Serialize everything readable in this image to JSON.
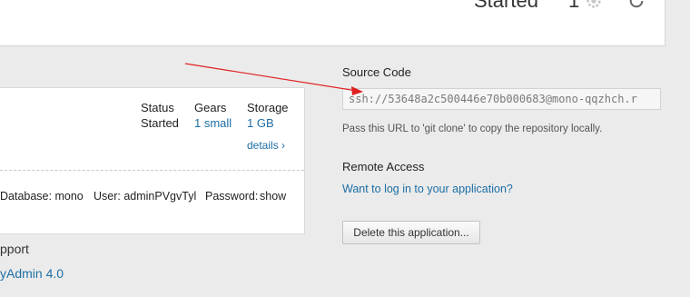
{
  "header": {
    "state": "Started",
    "gear_count": "1"
  },
  "app": {
    "status_label": "Status",
    "status_value": "Started",
    "gears_label": "Gears",
    "gears_value": "1 small",
    "storage_label": "Storage",
    "storage_value": "1 GB",
    "details_link": "details ›",
    "database_text": "Database: mono",
    "user_text": "User: adminPVgvTyl",
    "password_label": "Password:",
    "password_link": "show"
  },
  "support": {
    "label": "pport",
    "link": "yAdmin 4.0"
  },
  "source_code": {
    "title": "Source Code",
    "url": "ssh://53648a2c500446e70b000683@mono-qqzhch.r",
    "help": "Pass this URL to 'git clone' to copy the repository locally."
  },
  "remote_access": {
    "title": "Remote Access",
    "link": "Want to log in to your application?"
  },
  "actions": {
    "delete_label": "Delete this application..."
  },
  "colors": {
    "link": "#1d6fa5",
    "annotation_arrow": "#e02020"
  },
  "icons": [
    "gear-icon",
    "restart-icon",
    "annotation-arrow"
  ]
}
